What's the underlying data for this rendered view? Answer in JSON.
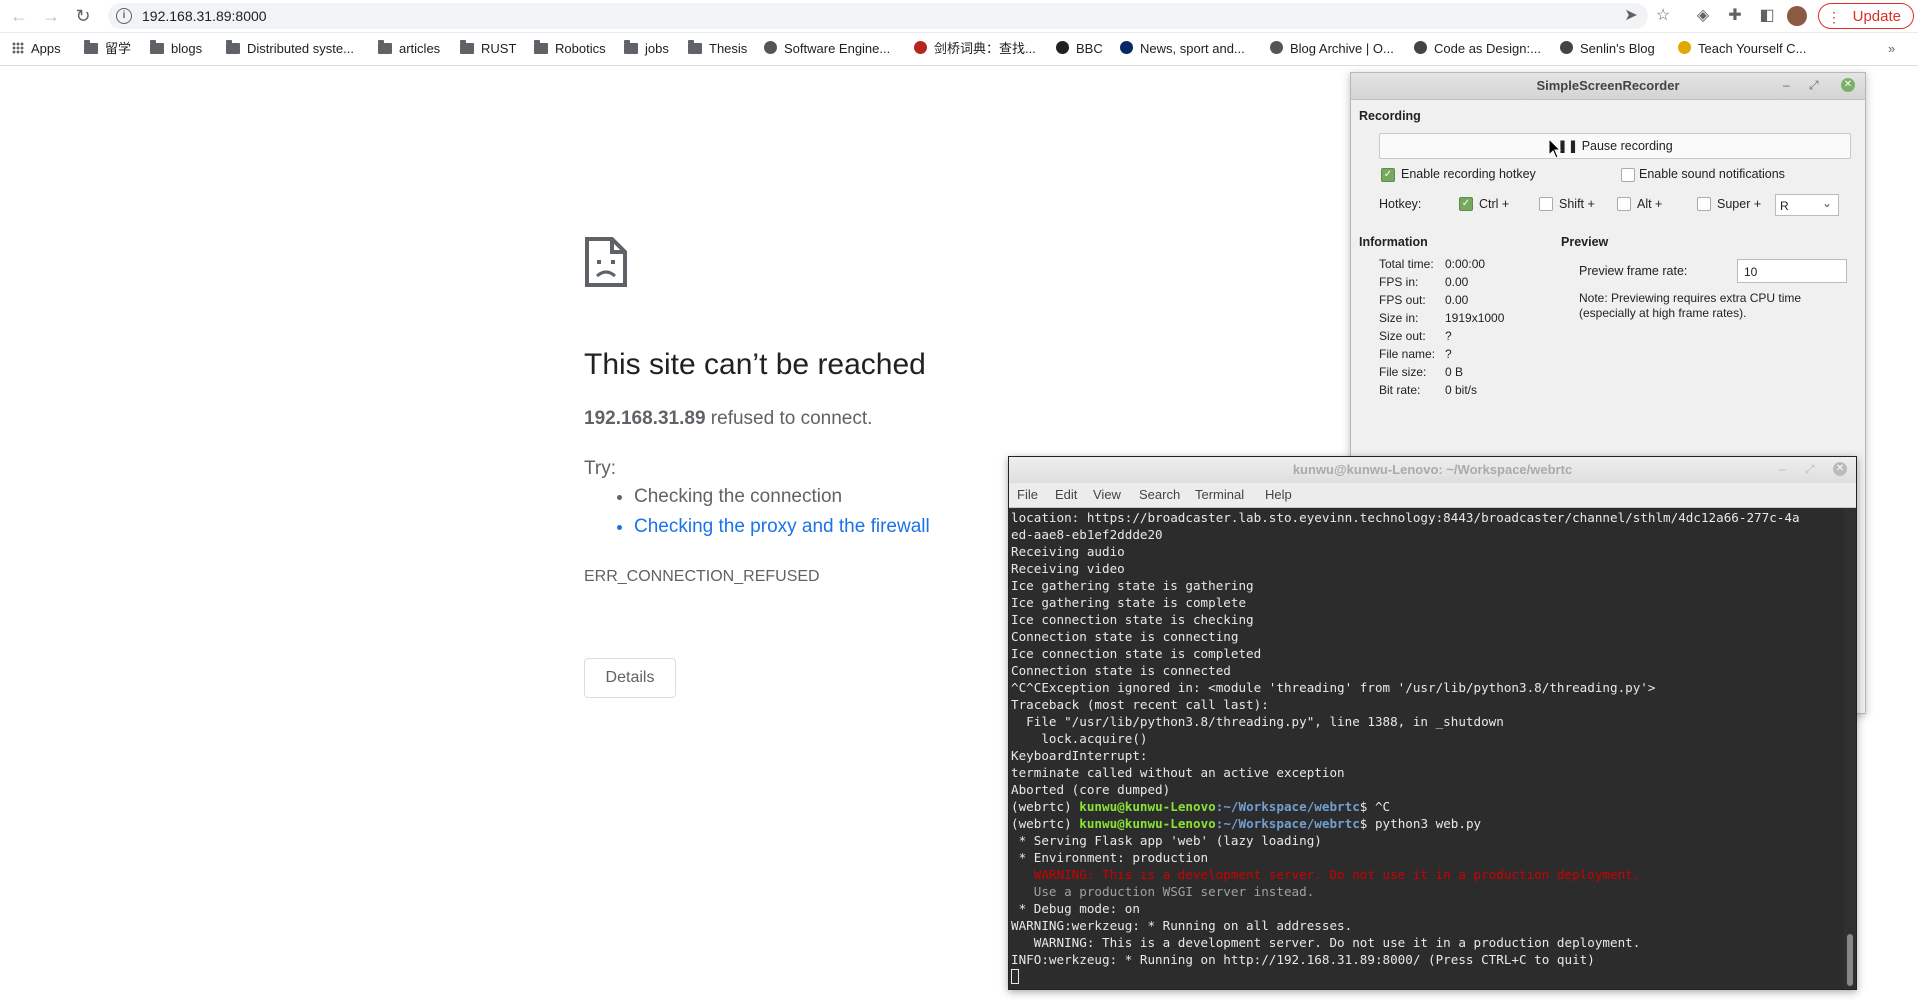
{
  "browser": {
    "url": "192.168.31.89:8000",
    "update_label": "Update",
    "bookmarks": [
      {
        "label": "Apps",
        "icon": "apps-grid-icon"
      },
      {
        "label": "留学",
        "icon": "folder-icon"
      },
      {
        "label": "blogs",
        "icon": "folder-icon"
      },
      {
        "label": "Distributed syste...",
        "icon": "folder-icon"
      },
      {
        "label": "articles",
        "icon": "folder-icon"
      },
      {
        "label": "RUST",
        "icon": "folder-icon"
      },
      {
        "label": "Robotics",
        "icon": "folder-icon"
      },
      {
        "label": "jobs",
        "icon": "folder-icon"
      },
      {
        "label": "Thesis",
        "icon": "folder-icon"
      },
      {
        "label": "Software Engine...",
        "icon": "site-icon"
      },
      {
        "label": "剑桥词典：查找...",
        "icon": "cambridge-icon"
      },
      {
        "label": "BBC",
        "icon": "bbc-icon"
      },
      {
        "label": "News, sport and...",
        "icon": "guardian-icon"
      },
      {
        "label": "Blog Archive | O...",
        "icon": "site-icon"
      },
      {
        "label": "Code as Design:...",
        "icon": "globe-icon"
      },
      {
        "label": "Senlin's Blog",
        "icon": "globe-icon"
      },
      {
        "label": "Teach Yourself C...",
        "icon": "key-icon"
      }
    ]
  },
  "error_page": {
    "title": "This site can’t be reached",
    "host": "192.168.31.89",
    "message_suffix": " refused to connect.",
    "try_label": "Try:",
    "suggestions": [
      "Checking the connection",
      "Checking the proxy and the firewall"
    ],
    "error_code": "ERR_CONNECTION_REFUSED",
    "details_label": "Details"
  },
  "recorder": {
    "title": "SimpleScreenRecorder",
    "recording_heading": "Recording",
    "pause_label": "Pause recording",
    "enable_hotkey_label": "Enable recording hotkey",
    "enable_hotkey_checked": true,
    "sound_notifications_label": "Enable sound notifications",
    "sound_notifications_checked": false,
    "hotkey_label": "Hotkey:",
    "ctrl_label": "Ctrl +",
    "ctrl_checked": true,
    "shift_label": "Shift +",
    "alt_label": "Alt +",
    "super_label": "Super +",
    "hotkey_key": "R",
    "information_heading": "Information",
    "info": [
      {
        "key": "Total time:",
        "value": "0:00:00"
      },
      {
        "key": "FPS in:",
        "value": "0.00"
      },
      {
        "key": "FPS out:",
        "value": "0.00"
      },
      {
        "key": "Size in:",
        "value": "1919x1000"
      },
      {
        "key": "Size out:",
        "value": "?"
      },
      {
        "key": "File name:",
        "value": "?"
      },
      {
        "key": "File size:",
        "value": "0 B"
      },
      {
        "key": "Bit rate:",
        "value": "0 bit/s"
      }
    ],
    "preview_heading": "Preview",
    "preview_rate_label": "Preview frame rate:",
    "preview_rate_value": "10",
    "preview_note": "Note: Previewing requires extra CPU time (especially at high frame rates)."
  },
  "terminal": {
    "title": "kunwu@kunwu-Lenovo: ~/Workspace/webrtc",
    "menu": [
      "File",
      "Edit",
      "View",
      "Search",
      "Terminal",
      "Help"
    ],
    "lines": [
      "location: https://broadcaster.lab.sto.eyevinn.technology:8443/broadcaster/channel/sthlm/4dc12a66-277c-4a",
      "ed-aae8-eb1ef2ddde20",
      "Receiving audio",
      "Receiving video",
      "Ice gathering state is gathering",
      "Ice gathering state is complete",
      "Ice connection state is checking",
      "Connection state is connecting",
      "Ice connection state is completed",
      "Connection state is connected",
      "^C^CException ignored in: <module 'threading' from '/usr/lib/python3.8/threading.py'>",
      "Traceback (most recent call last):",
      "  File \"/usr/lib/python3.8/threading.py\", line 1388, in _shutdown",
      "    lock.acquire()",
      "KeyboardInterrupt:",
      "terminate called without an active exception",
      "Aborted (core dumped)"
    ],
    "prompt_env": "(webrtc) ",
    "prompt_user": "kunwu@kunwu-Lenovo",
    "prompt_path": ":~/Workspace/webrtc",
    "prompt_cmd1": "$ ^C",
    "prompt_cmd2": "$ python3 web.py",
    "lines2": [
      " * Serving Flask app 'web' (lazy loading)",
      " * Environment: production"
    ],
    "warning_red": "   WARNING: This is a development server. Do not use it in a production deployment.",
    "warning_dim": "   Use a production WSGI server instead.",
    "lines3": [
      " * Debug mode: on",
      "WARNING:werkzeug: * Running on all addresses.",
      "   WARNING: This is a development server. Do not use it in a production deployment.",
      "INFO:werkzeug: * Running on http://192.168.31.89:8000/ (Press CTRL+C to quit)"
    ]
  },
  "colors": {
    "link": "#1a73e8",
    "update_red": "#d93025",
    "terminal_bg": "#2c2c2c",
    "prompt_green": "#8ae234",
    "prompt_blue": "#729fcf",
    "warning_red": "#cc0000",
    "checkbox_green": "#77a860"
  }
}
